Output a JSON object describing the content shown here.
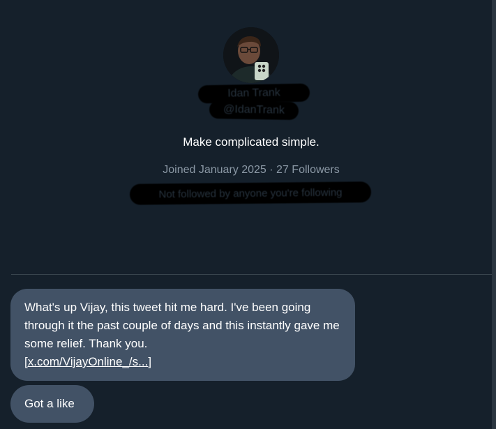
{
  "profile": {
    "name": "Idan Trank",
    "handle": "@IdanTrank",
    "bio": "Make complicated simple.",
    "joined": "Joined January 2025",
    "separator": "·",
    "followers": "27 Followers",
    "followed_by": "Not followed by anyone you're following"
  },
  "messages": [
    {
      "text": "What's up Vijay, this tweet hit me hard. I've been going through it the past couple of days and this instantly gave me some relief. Thank you.",
      "link": "[x.com/VijayOnline_/s...]"
    },
    {
      "text": "Got a like"
    }
  ],
  "colors": {
    "background": "#15202b",
    "bubble": "#425266",
    "divider": "#38444d",
    "muted_text": "#8b98a5"
  }
}
